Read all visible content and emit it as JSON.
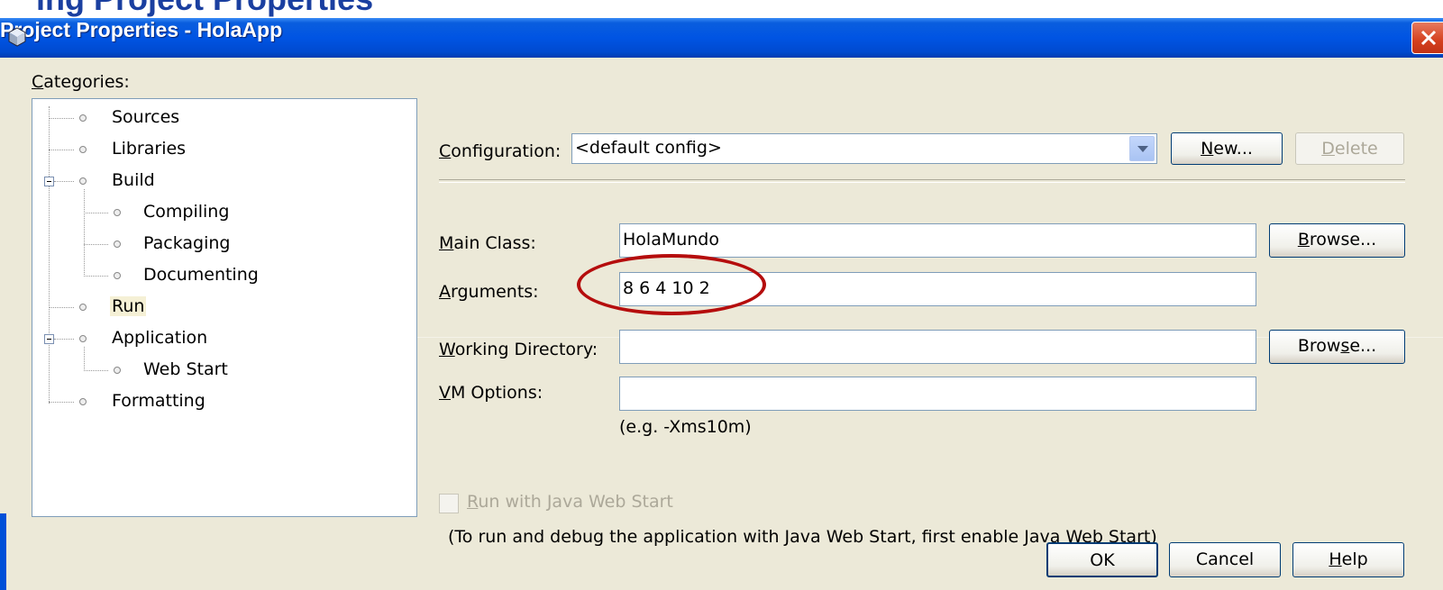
{
  "dialog": {
    "title": "Project Properties - HolaApp",
    "icon": "project-cube-icon"
  },
  "categories": {
    "label": "Categories:",
    "items": [
      {
        "label": "Sources"
      },
      {
        "label": "Libraries"
      },
      {
        "label": "Build"
      },
      {
        "label": "Compiling"
      },
      {
        "label": "Packaging"
      },
      {
        "label": "Documenting"
      },
      {
        "label": "Run",
        "selected": true
      },
      {
        "label": "Application"
      },
      {
        "label": "Web Start"
      },
      {
        "label": "Formatting"
      }
    ]
  },
  "configuration": {
    "label": "Configuration:",
    "value": "<default config>",
    "new_button": "New...",
    "delete_button": "Delete"
  },
  "main_class": {
    "label": "Main Class:",
    "value": "HolaMundo",
    "browse_button": "Browse..."
  },
  "arguments": {
    "label": "Arguments:",
    "value": "8 6 4 10 2"
  },
  "working_directory": {
    "label": "Working Directory:",
    "value": "",
    "browse_button": "Browse..."
  },
  "vm_options": {
    "label": "VM Options:",
    "value": "",
    "hint": "(e.g. -Xms10m)"
  },
  "web_start": {
    "checkbox_label": "Run with Java Web Start",
    "checked": false,
    "note": "(To run and debug the application with Java Web Start, first enable Java Web Start)"
  },
  "footer": {
    "ok": "OK",
    "cancel": "Cancel",
    "help": "Help"
  },
  "colors": {
    "titlebar": "#0054e3",
    "dialog_bg": "#ece9d8",
    "highlight": "#b50d0d"
  }
}
